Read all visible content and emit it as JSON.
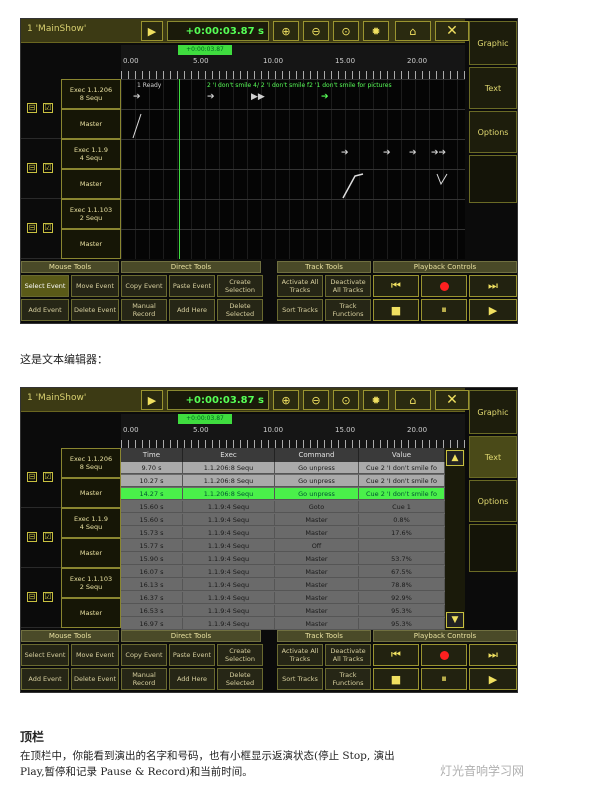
{
  "titlebar": {
    "show_name": "1 'MainShow'",
    "play_symbol": "▶",
    "time": "+0:00:03.87 s",
    "zoom_in": "⊕",
    "zoom_out": "⊖",
    "zoom_fit": "⊙",
    "lock_symbol": "✹",
    "disk_symbol": "⌂",
    "close_symbol": "✕"
  },
  "side": {
    "graphic": "Graphic",
    "text": "Text",
    "options": "Options"
  },
  "ruler": {
    "badge": "+0:00:03.87",
    "labels": [
      "0.00",
      "5.00",
      "10.00",
      "15.00",
      "20.00"
    ]
  },
  "tracks": [
    {
      "exec": "Exec 1.1.206",
      "sequ": "8 Sequ",
      "master": "Master"
    },
    {
      "exec": "Exec 1.1.9",
      "sequ": "4 Sequ",
      "master": "Master"
    },
    {
      "exec": "Exec 1.1.103",
      "sequ": "2 Sequ",
      "master": "Master"
    }
  ],
  "events1": {
    "e1": "1 Ready",
    "e2": "2 'I don't smile 4/ 2 'I don't smile f2 '1 don't smile for pictures"
  },
  "check": {
    "minus": "⊟",
    "box": "☑"
  },
  "tools": {
    "mouse_tools": "Mouse Tools",
    "direct_tools": "Direct Tools",
    "track_tools": "Track Tools",
    "playback_controls": "Playback Controls",
    "select_event": "Select Event",
    "move_event": "Move Event",
    "copy_event": "Copy Event",
    "paste_event": "Paste Event",
    "create_selection": "Create Selection",
    "activate_all": "Activate All Tracks",
    "deactivate_all": "Deactivate All Tracks",
    "add_event": "Add Event",
    "delete_event": "Delete Event",
    "manual_record": "Manual Record",
    "add_here": "Add Here",
    "delete_selected": "Delete Selected",
    "sort_tracks": "Sort Tracks",
    "track_functions": "Track Functions",
    "prev": "⏮",
    "next": "⏭",
    "stop": "■",
    "pause": "⏸",
    "play": "▶"
  },
  "table": {
    "headers": [
      "Time",
      "Exec",
      "Command",
      "Value"
    ],
    "rows": [
      [
        "9.70 s",
        "1.1.206:8 Sequ",
        "Go unpress",
        "Cue 2 'I don't smile fo"
      ],
      [
        "10.27 s",
        "1.1.206:8 Sequ",
        "Go unpress",
        "Cue 2 'I don't smile fo"
      ],
      [
        "14.27 s",
        "1.1.206:8 Sequ",
        "Go unpress",
        "Cue 2 'I don't smile fo"
      ],
      [
        "15.60 s",
        "1.1.9:4 Sequ",
        "Goto",
        "Cue 1"
      ],
      [
        "15.60 s",
        "1.1.9:4 Sequ",
        "Master",
        "0.8%"
      ],
      [
        "15.73 s",
        "1.1.9:4 Sequ",
        "Master",
        "17.6%"
      ],
      [
        "15.77 s",
        "1.1.9:4 Sequ",
        "Off",
        ""
      ],
      [
        "15.90 s",
        "1.1.9:4 Sequ",
        "Master",
        "53.7%"
      ],
      [
        "16.07 s",
        "1.1.9:4 Sequ",
        "Master",
        "67.5%"
      ],
      [
        "16.13 s",
        "1.1.9:4 Sequ",
        "Master",
        "78.8%"
      ],
      [
        "16.37 s",
        "1.1.9:4 Sequ",
        "Master",
        "92.9%"
      ],
      [
        "16.53 s",
        "1.1.9:4 Sequ",
        "Master",
        "95.3%"
      ],
      [
        "16.97 s",
        "1.1.9:4 Sequ",
        "Master",
        "95.3%"
      ]
    ],
    "scroll_up": "▲",
    "scroll_down": "▼"
  },
  "captions": {
    "text_editor": "这是文本编辑器：",
    "heading": "顶栏",
    "para_line1": "在顶栏中，你能看到演出的名字和号码，也有小框显示返演状态(停止 Stop, 演出",
    "para_line2": "Play,暂停和记录 Pause & Record)和当前时间。",
    "watermark": "灯光音响学习网"
  }
}
